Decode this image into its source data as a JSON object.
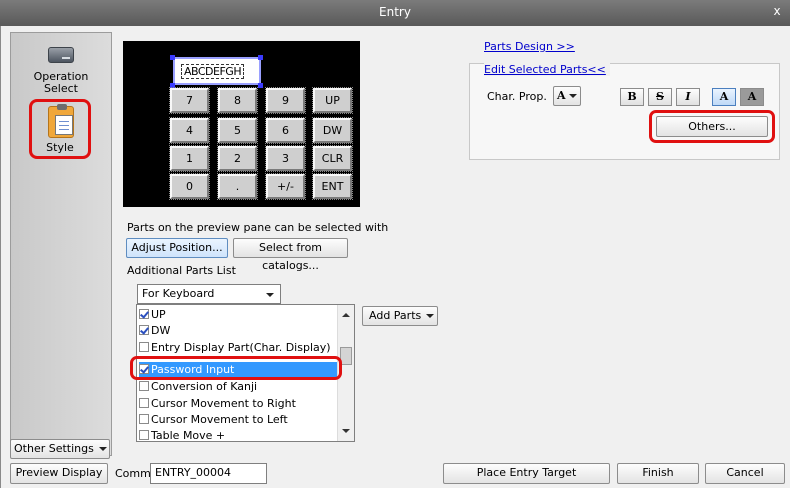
{
  "window": {
    "title": "Entry",
    "close_glyph": "x"
  },
  "left_nav": {
    "items": [
      {
        "label": "Operation Select",
        "icon": "drive-icon"
      },
      {
        "label": "Style",
        "icon": "clipboard-icon"
      }
    ],
    "other_settings": "Other Settings"
  },
  "preview": {
    "display_text": "ABCDEFGH",
    "keys": [
      "7",
      "8",
      "9",
      "UP",
      "4",
      "5",
      "6",
      "DW",
      "1",
      "2",
      "3",
      "CLR",
      "0",
      ".",
      "+/-",
      "ENT"
    ]
  },
  "links": {
    "parts_design": "Parts Design >>",
    "edit_selected": "Edit Selected Parts<<"
  },
  "char_prop": {
    "label": "Char. Prop.",
    "picker_glyph": "A",
    "style_buttons": [
      "B",
      "S",
      "I",
      "A",
      "A"
    ],
    "others_button": "Others..."
  },
  "parts": {
    "hint": "Parts on the preview pane can be selected with",
    "adjust_position": "Adjust Position...",
    "select_from_catalogs": "Select from catalogs..."
  },
  "additional": {
    "title": "Additional Parts List",
    "dropdown_value": "For Keyboard",
    "add_parts": "Add Parts",
    "items": [
      {
        "label": "UP",
        "checked": true
      },
      {
        "label": "DW",
        "checked": true
      },
      {
        "label": "Entry Display Part(Char. Display)",
        "checked": false
      },
      {
        "label": "Password Input",
        "checked": true
      },
      {
        "label": "Conversion of Kanji",
        "checked": false
      },
      {
        "label": "Cursor Movement to Right",
        "checked": false
      },
      {
        "label": "Cursor Movement to Left",
        "checked": false
      },
      {
        "label": "Table Move +",
        "checked": false
      }
    ]
  },
  "footer": {
    "preview_display": "Preview Display",
    "comm_label": "Comm",
    "comm_value": "ENTRY_00004",
    "place_entry_target": "Place Entry Target",
    "finish": "Finish",
    "cancel": "Cancel"
  },
  "colors": {
    "highlight_ring": "#e01010",
    "selection": "#3399ff",
    "link": "#0000cc"
  }
}
